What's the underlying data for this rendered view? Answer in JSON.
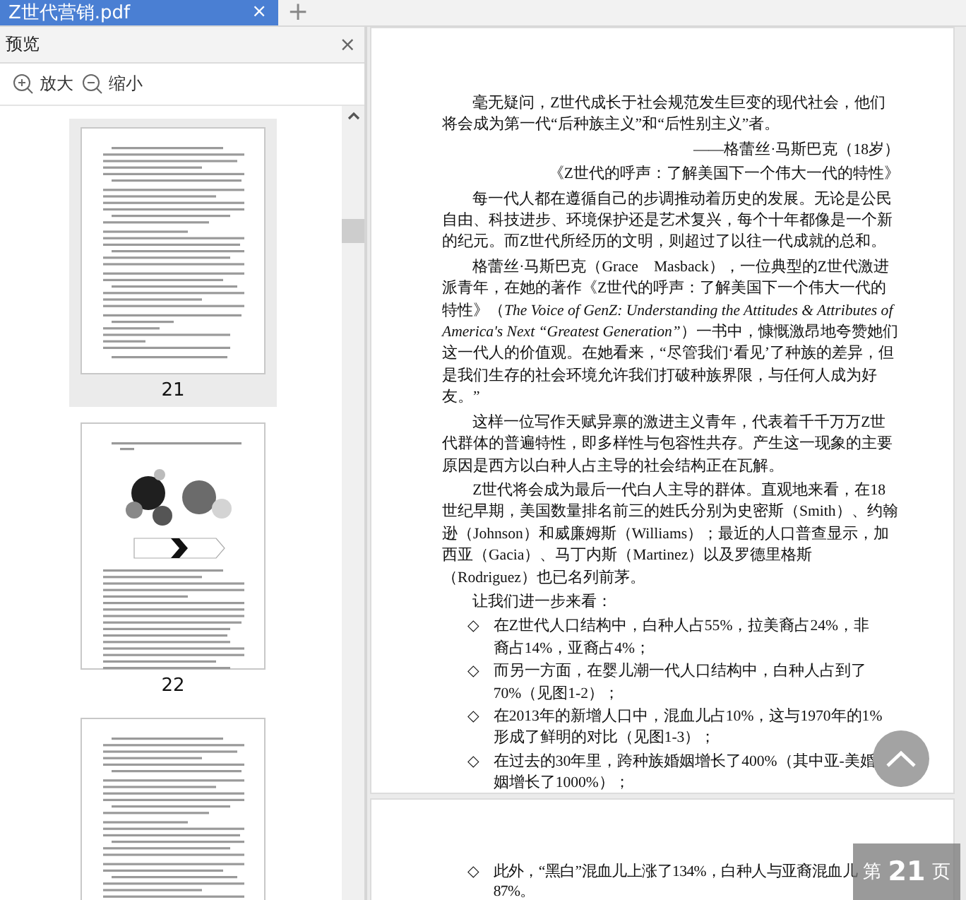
{
  "tabs": [
    {
      "title": "Z世代营销.pdf",
      "close": "×",
      "selected": true
    }
  ],
  "new_tab": "+",
  "sidebar": {
    "title": "预览",
    "close": "×",
    "tools": [
      {
        "kind": "zoom-in",
        "label": "放大"
      },
      {
        "kind": "zoom-out",
        "label": "缩小"
      }
    ],
    "thumbnails": [
      {
        "kind": "text",
        "page": "21",
        "selected": true
      },
      {
        "kind": "figure",
        "page": "22",
        "selected": false
      },
      {
        "kind": "text",
        "selected": false
      }
    ]
  },
  "pages": [
    {
      "blocks": [
        {
          "kind": "para",
          "text": "毫无疑问，Z世代成长于社会规范发生巨变的现代社会，他们将会成为第一代“后种族主义”和“后性别主义”者。"
        },
        {
          "kind": "right",
          "text": "——格蕾丝·马斯巴克（18岁）"
        },
        {
          "kind": "right",
          "text": "《Z世代的呼声：了解美国下一个伟大一代的特性》"
        },
        {
          "kind": "para",
          "text": "每一代人都在遵循自己的步调推动着历史的发展。无论是公民自由、科技进步、环境保护还是艺术复兴，每个十年都像是一个新的纪元。而Z世代所经历的文明，则超过了以往一代成就的总和。"
        },
        {
          "kind": "para",
          "text": "格蕾丝·马斯巴克（Grace　Masback），一位典型的Z世代激进派青年，在她的著作《Z世代的呼声：了解美国下一个伟大一代的特性》（*The Voice of GenZ: Understanding the Attitudes & Attributes of America's Next “Greatest Generation”*）一书中，慷慨激昂地夸赞她们这一代人的价值观。在她看来，“尽管我们‘看见’了种族的差异，但是我们生存的社会环境允许我们打破种族界限，与任何人成为好友。”"
        },
        {
          "kind": "para",
          "text": "这样一位写作天赋异禀的激进主义青年，代表着千千万万Z世代群体的普遍特性，即多样性与包容性共存。产生这一现象的主要原因是西方以白种人占主导的社会结构正在瓦解。"
        },
        {
          "kind": "para",
          "text": "Z世代将会成为最后一代白人主导的群体。直观地来看，在18世纪早期，美国数量排名前三的姓氏分别为史密斯（Smith）、约翰逊（Johnson）和威廉姆斯（Williams）；最近的人口普查显示，加西亚（Gacia）、马丁内斯（Martinez）以及罗德里格斯（Rodriguez）也已名列前茅。"
        },
        {
          "kind": "para",
          "text": "让我们进一步来看："
        },
        {
          "kind": "bullet",
          "marker": "◇",
          "lines": [
            "在Z世代人口结构中，白种人占55%，拉美裔占24%，非裔占14%，亚裔占4%；"
          ]
        },
        {
          "kind": "bullet",
          "marker": "◇",
          "lines": [
            "而另一方面，在婴儿潮一代人口结构中，白种人占到了70%（见图1-2）；"
          ]
        },
        {
          "kind": "bullet",
          "marker": "◇",
          "lines": [
            "在2013年的新增人口中，混血儿占10%，这与1970年的1%形成了鲜明的对比（见图1-3）；"
          ]
        },
        {
          "kind": "bullet",
          "marker": "◇",
          "lines": [
            "在过去的30年里，跨种族婚姻增长了400%（其中亚-美婚姻增长了1000%）；"
          ]
        }
      ]
    },
    {
      "blocks": [
        {
          "kind": "bullet",
          "marker": "◇",
          "lines": [
            "此外，“黑白”混血儿上涨了134%，白种人与亚裔混血儿",
            "87%。"
          ]
        }
      ]
    }
  ],
  "page_indicator": {
    "prefix": "第",
    "page": "21",
    "suffix": "页"
  }
}
